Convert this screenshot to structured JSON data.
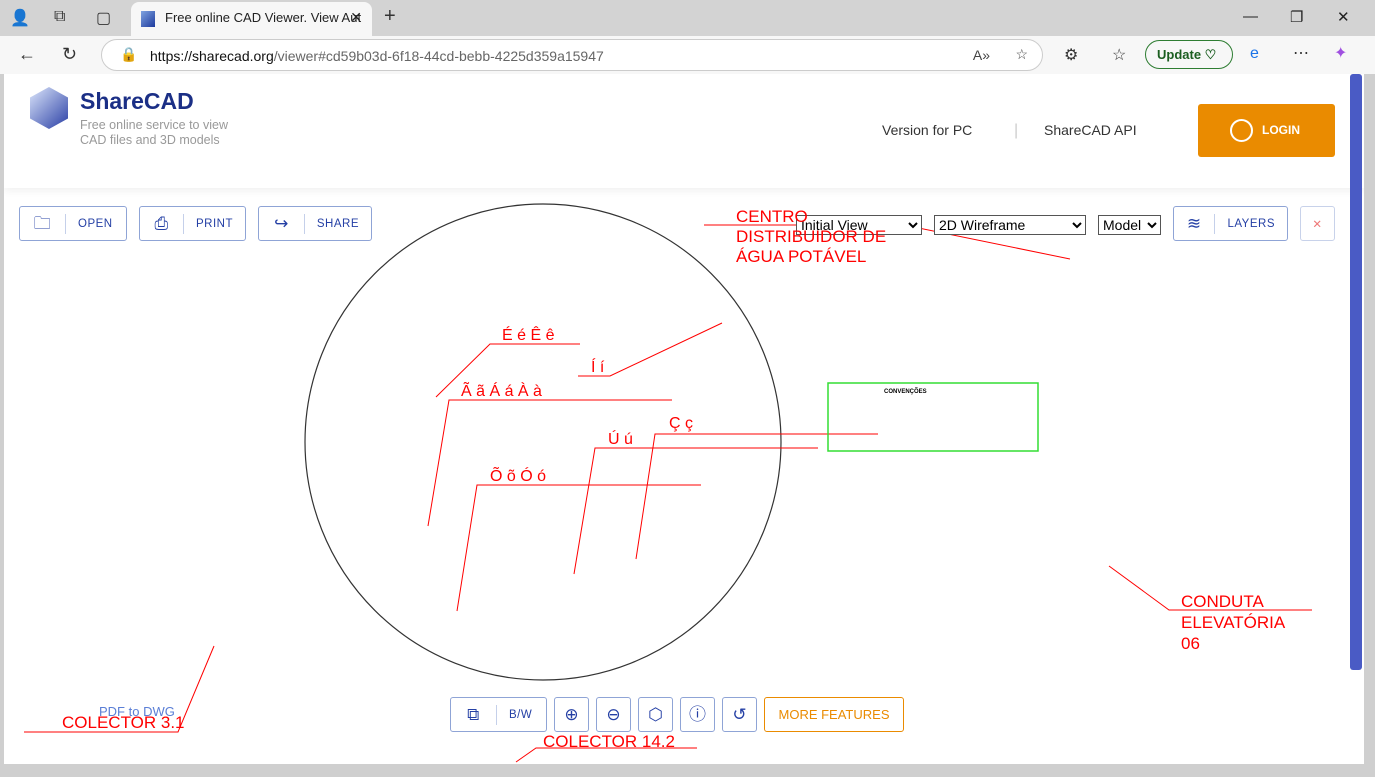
{
  "browser": {
    "tab_title": "Free online CAD Viewer. View Aut",
    "url_host": "https://sharecad.org",
    "url_path": "/viewer#cd59b03d-6f18-44cd-bebb-4225d359a15947",
    "update_label": "Update"
  },
  "header": {
    "brand": "ShareCAD",
    "tagline": "Free online service to view CAD files and 3D models",
    "nav": [
      "Version for PC",
      "ShareCAD API"
    ],
    "login": "LOGIN"
  },
  "toolbar": {
    "open": "OPEN",
    "print": "PRINT",
    "share": "SHARE",
    "view": "Initial View",
    "mode": "2D Wireframe",
    "space": "Model",
    "layers": "LAYERS",
    "close": "✕"
  },
  "bottom": {
    "bw": "B/W",
    "more": "MORE FEATURES",
    "pdf_link": "PDF to DWG"
  },
  "drawing": {
    "labels": [
      "CENTRO DISTRIBUIDOR DE ÁGUA POTÁVEL",
      "É é Ê ê",
      "Í í",
      "Ã ã Á á À à",
      "Ç ç",
      "Ú ú",
      "Õ õ Ó ó",
      "CONDUTA ELEVATÓRIA 06",
      "COLECTOR 3.1",
      "COLECTOR 14.2"
    ],
    "legend_title": "CONVENÇÕES"
  }
}
